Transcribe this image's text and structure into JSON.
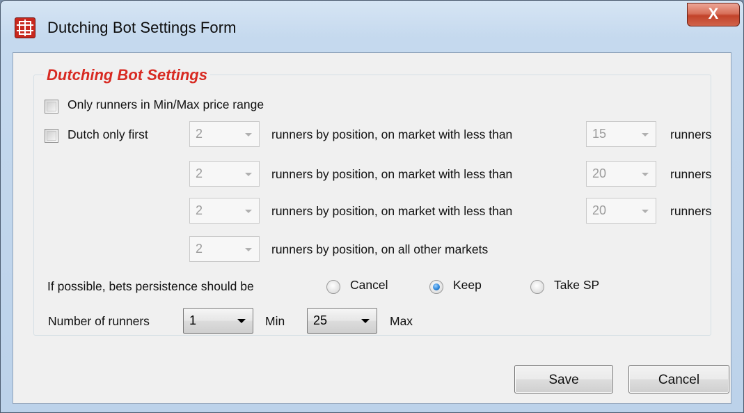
{
  "window": {
    "title": "Dutching Bot Settings Form",
    "close_glyph": "X",
    "app_icon": "grid-app-icon"
  },
  "group": {
    "title": "Dutching Bot Settings"
  },
  "options": {
    "min_max_label": "Only runners in Min/Max price range",
    "min_max_checked": false,
    "dutch_first_label": "Dutch only first",
    "dutch_first_checked": false
  },
  "rules": [
    {
      "count": "2",
      "text": "runners by position, on market with less than",
      "limit": "15",
      "suffix": "runners"
    },
    {
      "count": "2",
      "text": "runners by position, on market with less than",
      "limit": "20",
      "suffix": "runners"
    },
    {
      "count": "2",
      "text": "runners by position, on market with less than",
      "limit": "20",
      "suffix": "runners"
    },
    {
      "count": "2",
      "text": "runners by position, on all other markets"
    }
  ],
  "persistence": {
    "label": "If possible, bets persistence should be",
    "options": [
      "Cancel",
      "Keep",
      "Take SP"
    ],
    "selected": "Keep"
  },
  "runners": {
    "label": "Number of runners",
    "min_value": "1",
    "min_label": "Min",
    "max_value": "25",
    "max_label": "Max"
  },
  "buttons": {
    "save": "Save",
    "cancel": "Cancel"
  }
}
